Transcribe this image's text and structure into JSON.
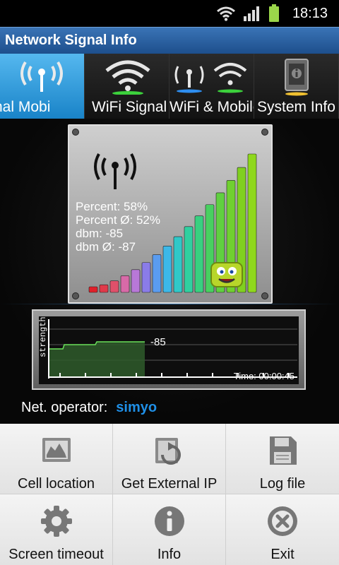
{
  "status_bar": {
    "time": "18:13",
    "icons": [
      "wifi-icon",
      "signal-icon",
      "battery-icon"
    ]
  },
  "app": {
    "title": "Network Signal Info"
  },
  "tabs": [
    {
      "label": "nal     Mobi",
      "icon": "cell-tower-icon",
      "active": true
    },
    {
      "label": "WiFi Signal",
      "icon": "wifi-icon",
      "active": false
    },
    {
      "label": "WiFi & Mobile",
      "icon": "wifi-mobile-icon",
      "active": false
    },
    {
      "label": "System Info",
      "icon": "phone-info-icon",
      "active": false
    }
  ],
  "signal": {
    "percent": "Percent: 58%",
    "percent_avg": "Percent Ø: 52%",
    "dbm": "dbm: -85",
    "dbm_avg": "dbm Ø: -87",
    "bars_total": 16,
    "bars_lit": 16
  },
  "history": {
    "ylabel": "strength",
    "current": "-85",
    "time": "Time: 00:00:45"
  },
  "operator": {
    "label": "Net. operator:",
    "value": "simyo"
  },
  "menu": [
    {
      "label": "Cell location",
      "icon": "map-icon"
    },
    {
      "label": "Get External IP",
      "icon": "refresh-window-icon"
    },
    {
      "label": "Log file",
      "icon": "save-disk-icon"
    },
    {
      "label": "Screen timeout",
      "icon": "gear-icon"
    },
    {
      "label": "Info",
      "icon": "info-icon"
    },
    {
      "label": "Exit",
      "icon": "close-circle-icon"
    }
  ],
  "colors": {
    "accent": "#1f8fe6",
    "title_bar": "#2a5fa0",
    "active_tab": "#3aa8e8"
  }
}
